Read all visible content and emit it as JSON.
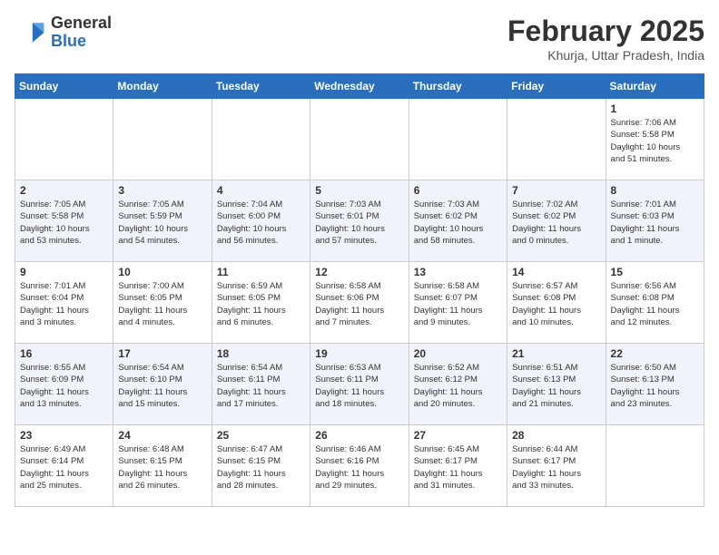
{
  "header": {
    "logo_general": "General",
    "logo_blue": "Blue",
    "month": "February 2025",
    "location": "Khurja, Uttar Pradesh, India"
  },
  "weekdays": [
    "Sunday",
    "Monday",
    "Tuesday",
    "Wednesday",
    "Thursday",
    "Friday",
    "Saturday"
  ],
  "weeks": [
    [
      {
        "day": "",
        "info": ""
      },
      {
        "day": "",
        "info": ""
      },
      {
        "day": "",
        "info": ""
      },
      {
        "day": "",
        "info": ""
      },
      {
        "day": "",
        "info": ""
      },
      {
        "day": "",
        "info": ""
      },
      {
        "day": "1",
        "info": "Sunrise: 7:06 AM\nSunset: 5:58 PM\nDaylight: 10 hours\nand 51 minutes."
      }
    ],
    [
      {
        "day": "2",
        "info": "Sunrise: 7:05 AM\nSunset: 5:58 PM\nDaylight: 10 hours\nand 53 minutes."
      },
      {
        "day": "3",
        "info": "Sunrise: 7:05 AM\nSunset: 5:59 PM\nDaylight: 10 hours\nand 54 minutes."
      },
      {
        "day": "4",
        "info": "Sunrise: 7:04 AM\nSunset: 6:00 PM\nDaylight: 10 hours\nand 56 minutes."
      },
      {
        "day": "5",
        "info": "Sunrise: 7:03 AM\nSunset: 6:01 PM\nDaylight: 10 hours\nand 57 minutes."
      },
      {
        "day": "6",
        "info": "Sunrise: 7:03 AM\nSunset: 6:02 PM\nDaylight: 10 hours\nand 58 minutes."
      },
      {
        "day": "7",
        "info": "Sunrise: 7:02 AM\nSunset: 6:02 PM\nDaylight: 11 hours\nand 0 minutes."
      },
      {
        "day": "8",
        "info": "Sunrise: 7:01 AM\nSunset: 6:03 PM\nDaylight: 11 hours\nand 1 minute."
      }
    ],
    [
      {
        "day": "9",
        "info": "Sunrise: 7:01 AM\nSunset: 6:04 PM\nDaylight: 11 hours\nand 3 minutes."
      },
      {
        "day": "10",
        "info": "Sunrise: 7:00 AM\nSunset: 6:05 PM\nDaylight: 11 hours\nand 4 minutes."
      },
      {
        "day": "11",
        "info": "Sunrise: 6:59 AM\nSunset: 6:05 PM\nDaylight: 11 hours\nand 6 minutes."
      },
      {
        "day": "12",
        "info": "Sunrise: 6:58 AM\nSunset: 6:06 PM\nDaylight: 11 hours\nand 7 minutes."
      },
      {
        "day": "13",
        "info": "Sunrise: 6:58 AM\nSunset: 6:07 PM\nDaylight: 11 hours\nand 9 minutes."
      },
      {
        "day": "14",
        "info": "Sunrise: 6:57 AM\nSunset: 6:08 PM\nDaylight: 11 hours\nand 10 minutes."
      },
      {
        "day": "15",
        "info": "Sunrise: 6:56 AM\nSunset: 6:08 PM\nDaylight: 11 hours\nand 12 minutes."
      }
    ],
    [
      {
        "day": "16",
        "info": "Sunrise: 6:55 AM\nSunset: 6:09 PM\nDaylight: 11 hours\nand 13 minutes."
      },
      {
        "day": "17",
        "info": "Sunrise: 6:54 AM\nSunset: 6:10 PM\nDaylight: 11 hours\nand 15 minutes."
      },
      {
        "day": "18",
        "info": "Sunrise: 6:54 AM\nSunset: 6:11 PM\nDaylight: 11 hours\nand 17 minutes."
      },
      {
        "day": "19",
        "info": "Sunrise: 6:53 AM\nSunset: 6:11 PM\nDaylight: 11 hours\nand 18 minutes."
      },
      {
        "day": "20",
        "info": "Sunrise: 6:52 AM\nSunset: 6:12 PM\nDaylight: 11 hours\nand 20 minutes."
      },
      {
        "day": "21",
        "info": "Sunrise: 6:51 AM\nSunset: 6:13 PM\nDaylight: 11 hours\nand 21 minutes."
      },
      {
        "day": "22",
        "info": "Sunrise: 6:50 AM\nSunset: 6:13 PM\nDaylight: 11 hours\nand 23 minutes."
      }
    ],
    [
      {
        "day": "23",
        "info": "Sunrise: 6:49 AM\nSunset: 6:14 PM\nDaylight: 11 hours\nand 25 minutes."
      },
      {
        "day": "24",
        "info": "Sunrise: 6:48 AM\nSunset: 6:15 PM\nDaylight: 11 hours\nand 26 minutes."
      },
      {
        "day": "25",
        "info": "Sunrise: 6:47 AM\nSunset: 6:15 PM\nDaylight: 11 hours\nand 28 minutes."
      },
      {
        "day": "26",
        "info": "Sunrise: 6:46 AM\nSunset: 6:16 PM\nDaylight: 11 hours\nand 29 minutes."
      },
      {
        "day": "27",
        "info": "Sunrise: 6:45 AM\nSunset: 6:17 PM\nDaylight: 11 hours\nand 31 minutes."
      },
      {
        "day": "28",
        "info": "Sunrise: 6:44 AM\nSunset: 6:17 PM\nDaylight: 11 hours\nand 33 minutes."
      },
      {
        "day": "",
        "info": ""
      }
    ]
  ]
}
